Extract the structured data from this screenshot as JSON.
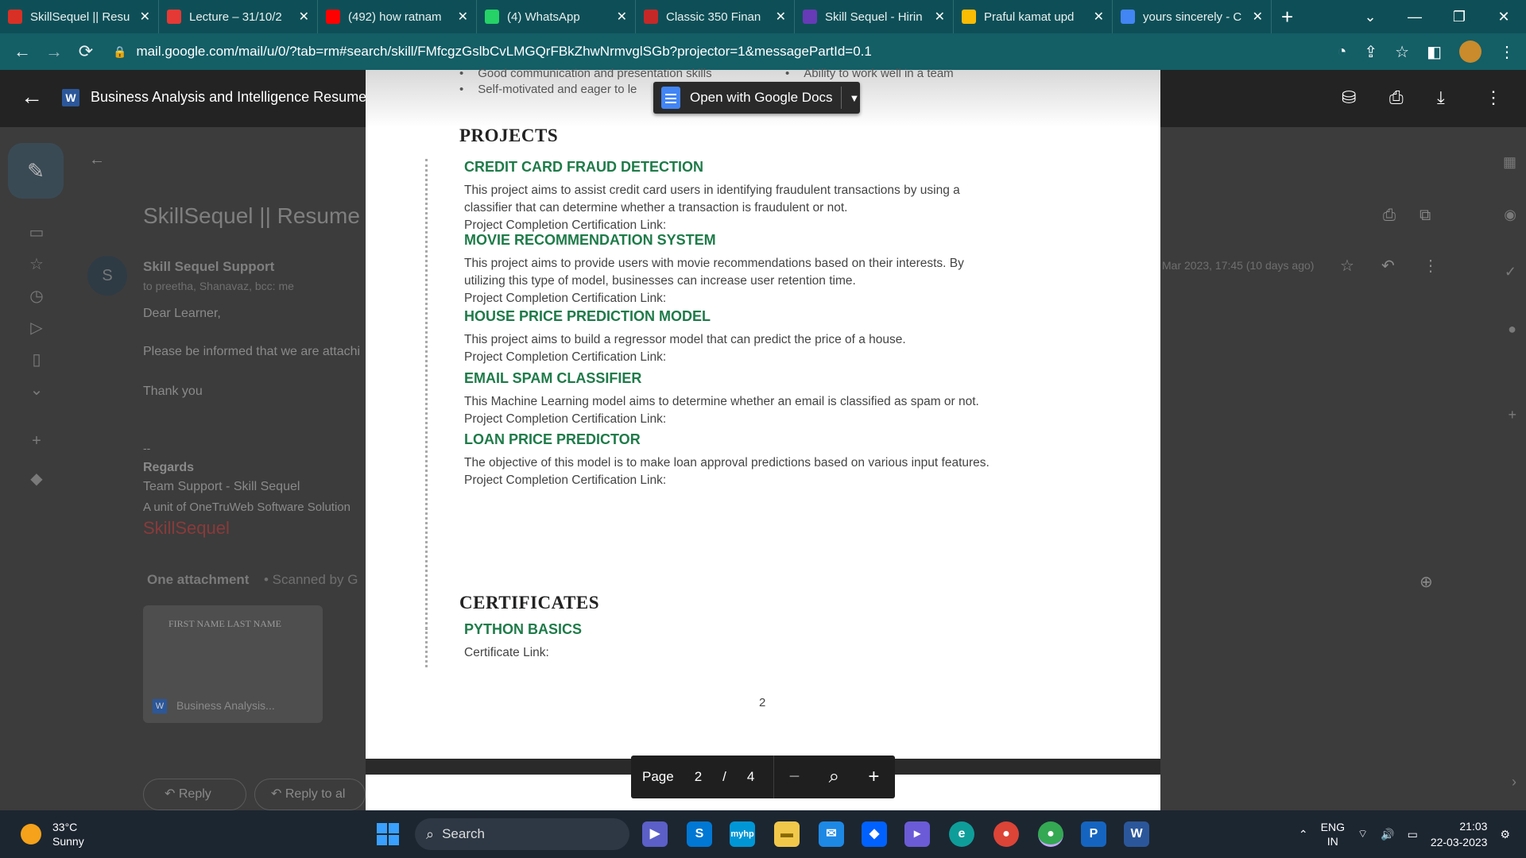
{
  "browser": {
    "tabs": [
      {
        "title": "SkillSequel || Resu",
        "icon": "gmail-icon",
        "color": "#d93025",
        "active": true
      },
      {
        "title": "Lecture – 31/10/2",
        "icon": "skillsequel-icon",
        "color": "#e53935"
      },
      {
        "title": "(492) how ratnam",
        "icon": "youtube-icon",
        "color": "#ff0000"
      },
      {
        "title": "(4) WhatsApp",
        "icon": "whatsapp-icon",
        "color": "#25d366"
      },
      {
        "title": "Classic 350 Finan",
        "icon": "royal-enfield-icon",
        "color": "#c62828"
      },
      {
        "title": "Skill Sequel - Hirin",
        "icon": "forms-icon",
        "color": "#673ab7"
      },
      {
        "title": "Praful kamat upd",
        "icon": "drive-icon",
        "color": "#fbbc04"
      },
      {
        "title": "yours sincerely - C",
        "icon": "google-icon",
        "color": "#4285f4"
      }
    ],
    "url": "mail.google.com/mail/u/0/?tab=rm#search/skill/FMfcgzGslbCvLMGQrFBkZhwNrmvglSGb?projector=1&messagePartId=0.1"
  },
  "viewer": {
    "file_name": "Business Analysis and Intelligence Resume Draft.docx",
    "open_with": "Open with Google Docs"
  },
  "gmail": {
    "subject": "SkillSequel || Resume T",
    "sender": "Skill Sequel Support",
    "avatar_letter": "S",
    "recipients": "to preetha, Shanavaz, bcc: me",
    "date": "Mar 2023, 17:45 (10 days ago)",
    "greeting": "Dear Learner,",
    "line1": "Please be informed that we are attachi",
    "thanks": "Thank you",
    "dashes": "--",
    "regards": "Regards",
    "team": "Team Support - Skill Sequel",
    "unit": "A unit of OneTruWeb Software Solution",
    "logo_text": "SkillSequel",
    "attachment_label": "One attachment",
    "scanned": "• Scanned by G",
    "thumb_name": "FIRST NAME LAST NAME",
    "attachment_name": "Business Analysis...",
    "reply": "Reply",
    "reply_all": "Reply to al"
  },
  "document": {
    "top_items": [
      "Good communication and presentation skills",
      "Ability to work well in a team",
      "Self-motivated and eager to le"
    ],
    "projects_heading": "PROJECTS",
    "projects": [
      {
        "title": "CREDIT CARD FRAUD DETECTION",
        "lines": [
          "This project aims to assist credit card users in identifying fraudulent transactions by using a",
          "classifier that can determine whether a transaction is fraudulent or not.",
          "Project Completion Certification Link:"
        ]
      },
      {
        "title": "MOVIE RECOMMENDATION SYSTEM",
        "lines": [
          "This project aims to provide users with movie recommendations based on their interests. By",
          "utilizing this type of model, businesses can increase user retention time.",
          "Project Completion Certification Link:"
        ]
      },
      {
        "title": "HOUSE PRICE PREDICTION MODEL",
        "lines": [
          "This project aims to build a regressor model that can predict the price of a house.",
          "Project Completion Certification Link:"
        ]
      },
      {
        "title": "EMAIL SPAM CLASSIFIER",
        "lines": [
          "This Machine Learning model aims to determine whether an email is classified as spam or not.",
          "Project Completion Certification Link:"
        ]
      },
      {
        "title": "LOAN PRICE PREDICTOR",
        "lines": [
          "The objective of this model is to make loan approval predictions based on various input features.",
          "Project Completion Certification Link:"
        ]
      }
    ],
    "certificates_heading": "CERTIFICATES",
    "certificates": [
      {
        "title": "PYTHON BASICS",
        "lines": [
          "Certificate Link:"
        ]
      }
    ],
    "page_number": "2"
  },
  "pager": {
    "label": "Page",
    "current": "2",
    "separator": "/",
    "total": "4"
  },
  "taskbar": {
    "temperature": "33°C",
    "weather": "Sunny",
    "search": "Search",
    "lang1": "ENG",
    "lang2": "IN",
    "time": "21:03",
    "date": "22-03-2023"
  }
}
